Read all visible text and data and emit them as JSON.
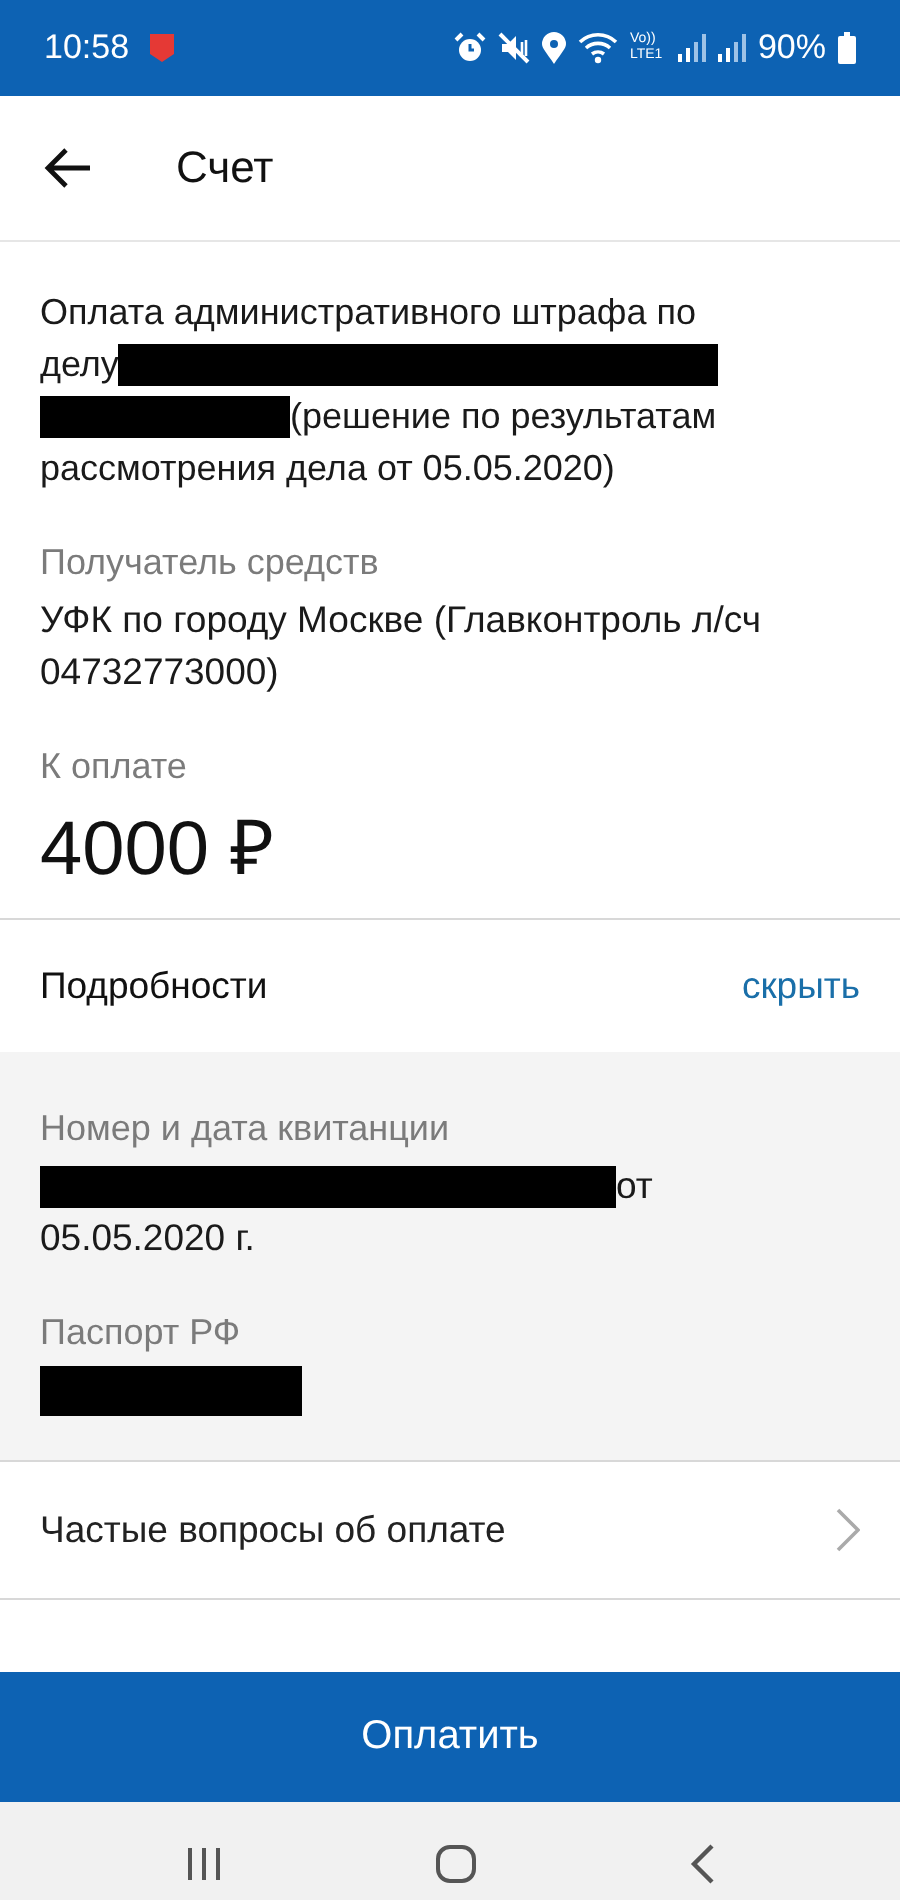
{
  "status_bar": {
    "time": "10:58",
    "network": "Vo)) LTE1",
    "battery": "90%"
  },
  "app_bar": {
    "title": "Счет"
  },
  "description": [
    [
      {
        "kind": "text",
        "text": "Оплата административного штрафа по"
      }
    ],
    [
      {
        "kind": "text",
        "text": "делу"
      },
      {
        "kind": "redaction_long"
      }
    ],
    [
      {
        "kind": "redaction_short"
      },
      {
        "kind": "text",
        "text": "(решение по результатам"
      }
    ],
    [
      {
        "kind": "text",
        "text": "рассмотрения дела от 05.05.2020)"
      }
    ]
  ],
  "recipient": {
    "label": "Получатель средств",
    "value": "УФК по городу Москве (Главконтроль л/сч 04732773000)"
  },
  "amount": {
    "label": "К оплате",
    "value": "4000 ₽"
  },
  "details": {
    "title": "Подробности",
    "toggle": "скрыть",
    "expanded": true,
    "fields": [
      {
        "label": "Номер и дата квитанции",
        "value": [
          [
            {
              "kind": "redaction_wide"
            },
            {
              "kind": "text",
              "text": "от"
            }
          ],
          [
            {
              "kind": "text",
              "text": "05.05.2020 г."
            }
          ]
        ]
      },
      {
        "label": "Паспорт РФ",
        "value": [
          [
            {
              "kind": "redaction_small"
            }
          ]
        ]
      }
    ]
  },
  "faq": {
    "label": "Частые вопросы об оплате"
  },
  "pay_button": {
    "label": "Оплатить"
  }
}
